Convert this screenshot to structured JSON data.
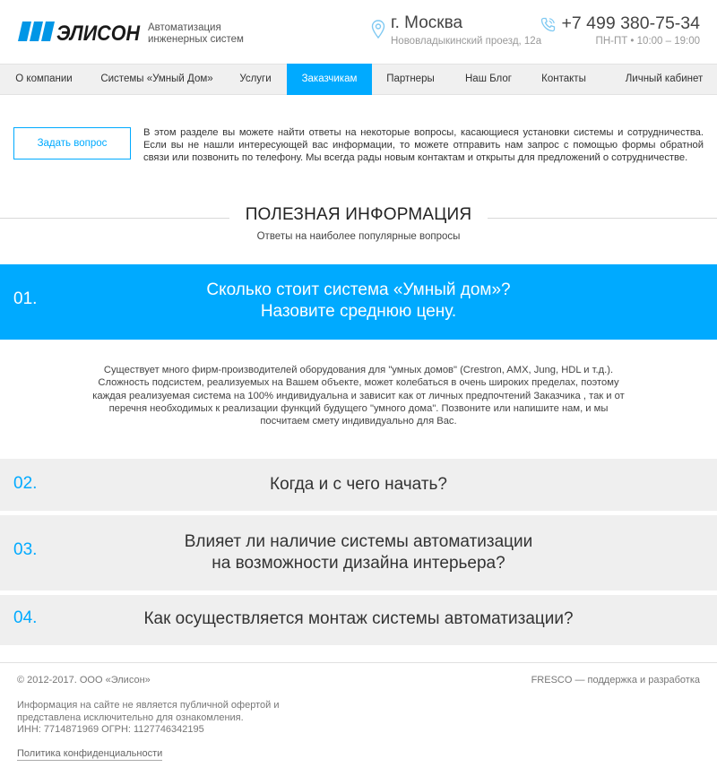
{
  "header": {
    "logo_text": "ЭЛИСОН",
    "tagline_line1": "Автоматизация",
    "tagline_line2": "инженерных систем",
    "city": "г. Москва",
    "address": "Нововладыкинский проезд, 12а",
    "phone": "+7 499 380-75-34",
    "hours": "ПН-ПТ • 10:00 – 19:00"
  },
  "nav": {
    "items": [
      {
        "label": "О компании"
      },
      {
        "label": "Системы «Умный Дом»"
      },
      {
        "label": "Услуги"
      },
      {
        "label": "Заказчикам"
      },
      {
        "label": "Партнеры"
      },
      {
        "label": "Наш Блог"
      },
      {
        "label": "Контакты"
      },
      {
        "label": "Личный кабинет"
      }
    ],
    "active_index": 3
  },
  "intro": {
    "button_label": "Задать вопрос",
    "text": "В этом разделе вы можете найти ответы на некоторые вопросы, касающиеся установки системы и сотрудничества. Если вы не нашли интересующей вас информации, то можете отправить нам запрос с помощью формы обратной связи или позвонить по телефону. Мы всегда рады новым контактам и открыты для предложений о сотрудничестве."
  },
  "section": {
    "title": "ПОЛЕЗНАЯ ИНФОРМАЦИЯ",
    "subtitle": "Ответы на наиболее популярные вопросы"
  },
  "faq": [
    {
      "number": "01.",
      "question_line1": "Сколько стоит система «Умный дом»?",
      "question_line2": "Назовите среднюю цену.",
      "expanded": true,
      "answer": "Существует много фирм-производителей оборудования для \"умных домов\" (Crestron, AMX, Jung, HDL и т.д.). Сложность подсистем, реализуемых на Вашем объекте, может колебаться в очень широких пределах, поэтому каждая реализуемая система на 100% индивидуальна и зависит как от личных предпочтений Заказчика , так и от перечня необходимых к реализации функций будущего \"умного дома\". Позвоните или напишите нам, и мы посчитаем смету индивидуально для Вас."
    },
    {
      "number": "02.",
      "question_line1": "Когда и с чего начать?",
      "expanded": false
    },
    {
      "number": "03.",
      "question_line1": "Влияет ли наличие системы автоматизации",
      "question_line2": "на возможности дизайна интерьера?",
      "expanded": false
    },
    {
      "number": "04.",
      "question_line1": "Как осуществляется монтаж системы автоматизации?",
      "expanded": false
    }
  ],
  "footer": {
    "copyright": "© 2012-2017. ООО «Элисон»",
    "developer": "FRESCO — поддержка и разработка",
    "disclaimer_line1": "Информация на сайте не является публичной офертой и",
    "disclaimer_line2": "представлена исключительно для ознакомления.",
    "disclaimer_line3": "ИНН: 7714871969 ОГРН: 1127746342195",
    "privacy_link": "Политика конфиденциальности"
  },
  "colors": {
    "accent": "#00aaff",
    "brand_dark": "#1a1a1a",
    "gray_panel": "#efefef"
  },
  "icons": {
    "location": "map-pin-icon",
    "phone": "phone-icon"
  }
}
